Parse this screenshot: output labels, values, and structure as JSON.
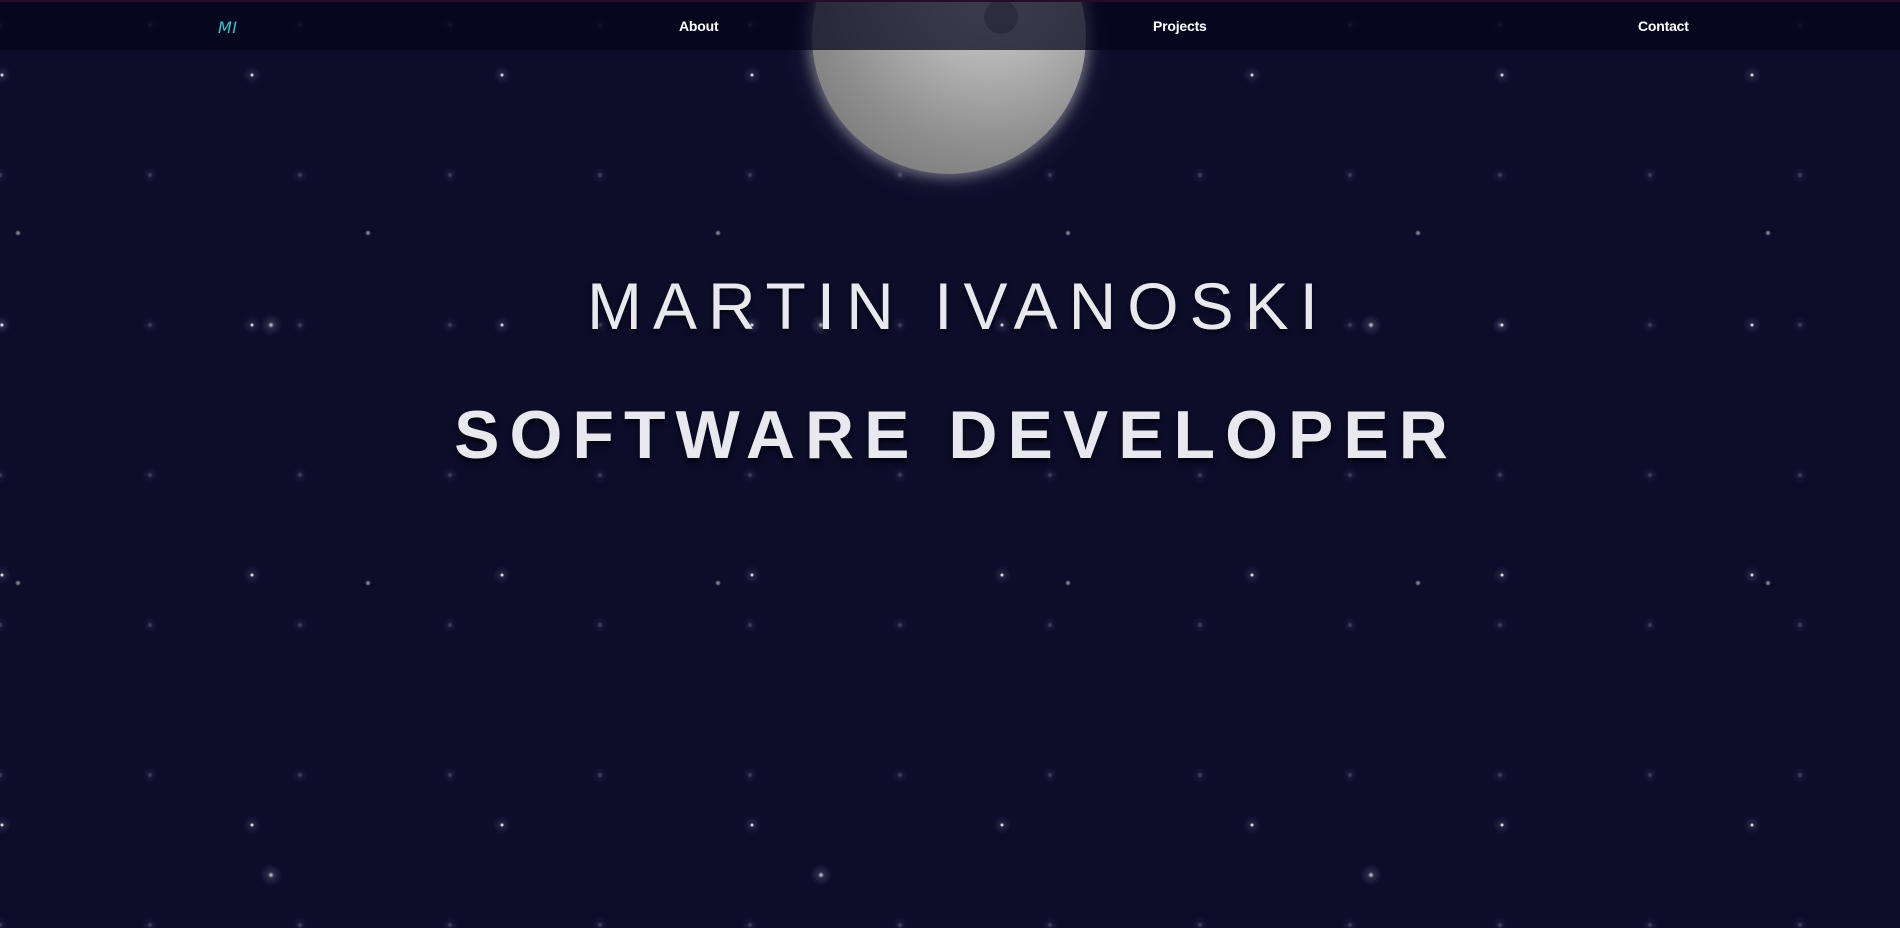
{
  "nav": {
    "logo": "MI",
    "links": [
      {
        "label": "About"
      },
      {
        "label": "Projects"
      },
      {
        "label": "Contact"
      }
    ]
  },
  "hero": {
    "name": "MARTIN IVANOSKI",
    "role": "SOFTWARE DEVELOPER"
  },
  "colors": {
    "background": "#0d0c29",
    "logo_accent": "#35c6c6",
    "nav_text": "#ffffff",
    "hero_text": "#e8e8ee",
    "moon": "#a8a8a8"
  }
}
